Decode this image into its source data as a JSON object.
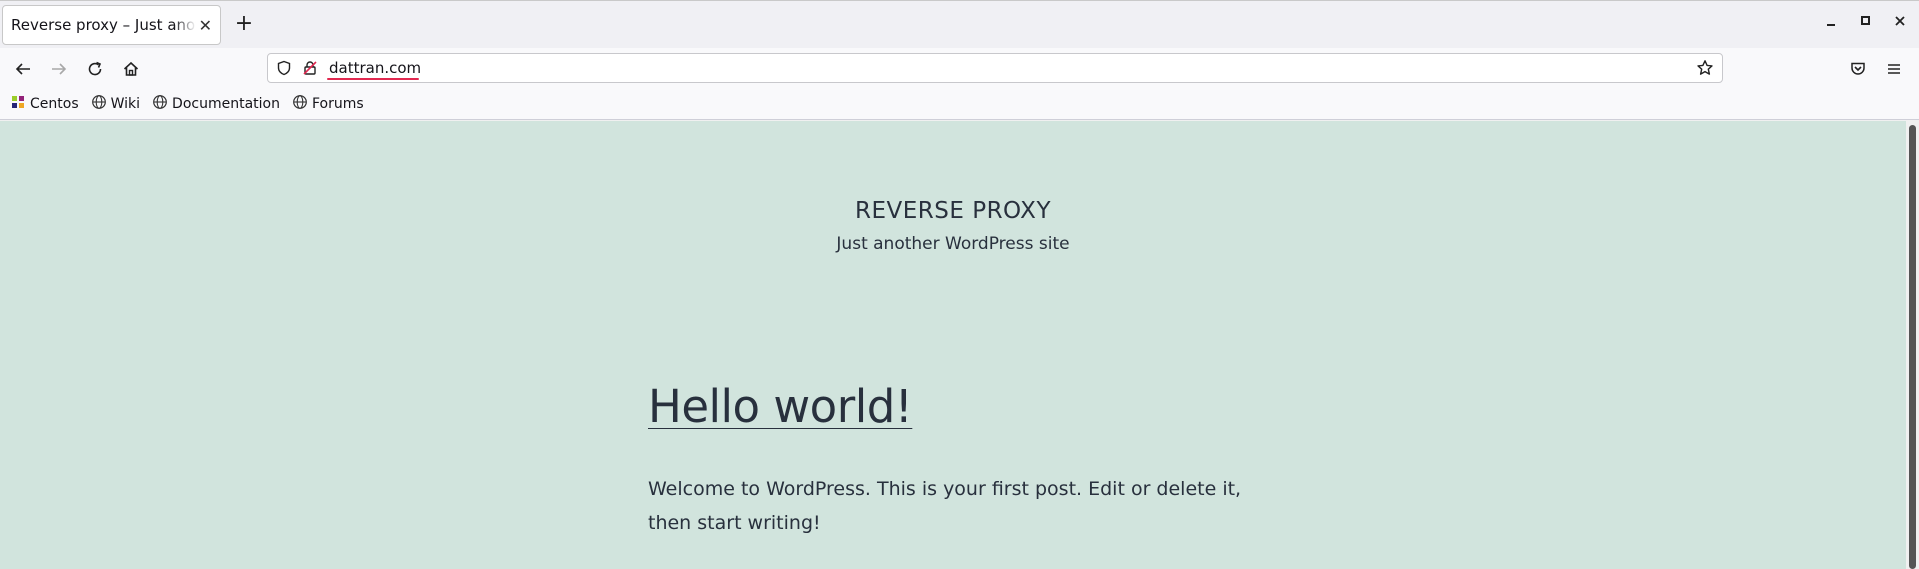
{
  "tabs": [
    {
      "title": "Reverse proxy – Just another WordPress site"
    }
  ],
  "address_bar": {
    "url": "dattran.com"
  },
  "bookmarks": [
    {
      "label": "Centos",
      "icon": "centos-icon"
    },
    {
      "label": "Wiki",
      "icon": "globe-icon"
    },
    {
      "label": "Documentation",
      "icon": "globe-icon"
    },
    {
      "label": "Forums",
      "icon": "globe-icon"
    }
  ],
  "page": {
    "site_title": "REVERSE PROXY",
    "site_description": "Just another WordPress site",
    "post_title": "Hello world!",
    "post_body": "Welcome to WordPress. This is your first post. Edit or delete it, then start writing!"
  },
  "colors": {
    "page_background": "#d1e4dd",
    "text": "#28303d",
    "url_underline": "#e22850"
  }
}
